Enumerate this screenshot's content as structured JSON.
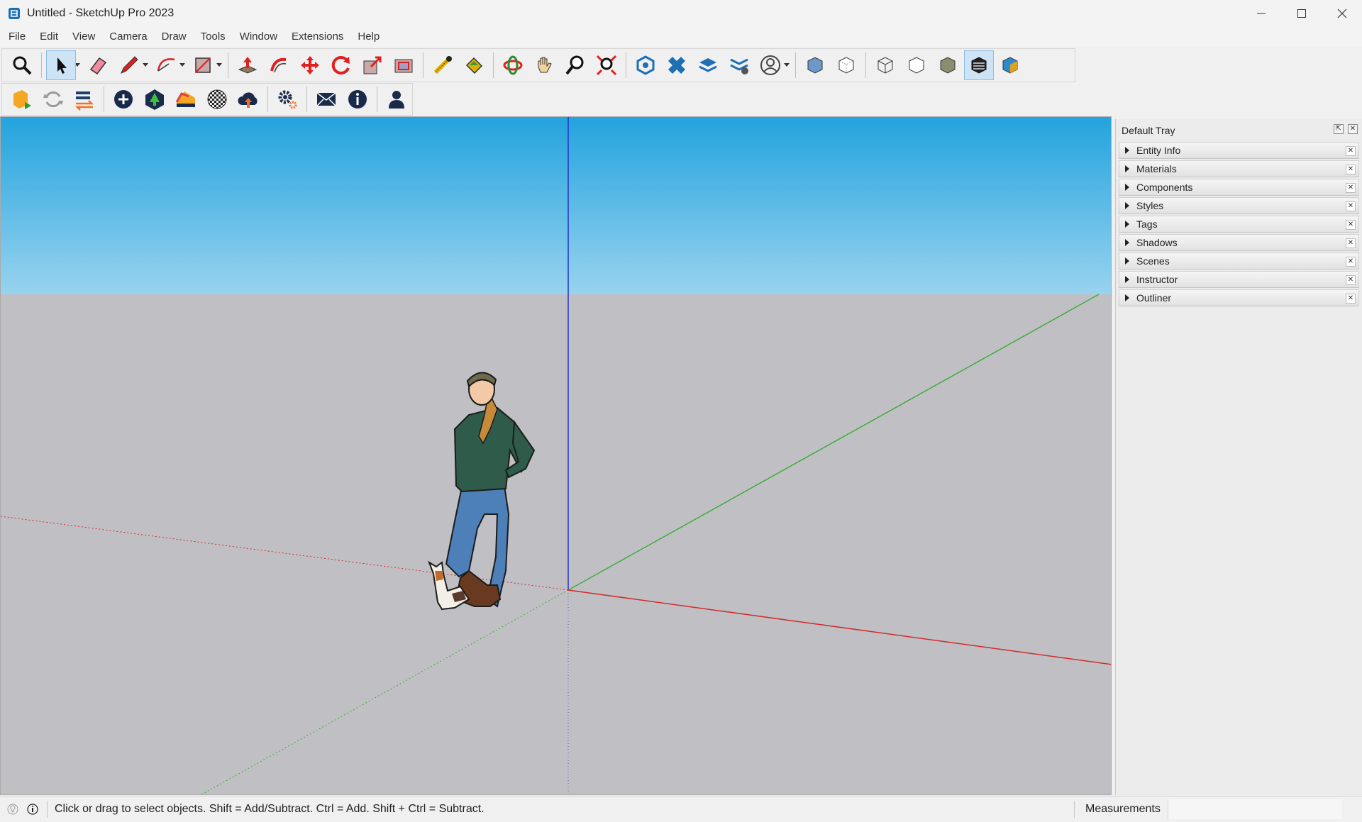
{
  "window": {
    "title": "Untitled - SketchUp Pro 2023",
    "controls": [
      "minimize",
      "maximize",
      "close"
    ]
  },
  "menu": [
    "File",
    "Edit",
    "View",
    "Camera",
    "Draw",
    "Tools",
    "Window",
    "Extensions",
    "Help"
  ],
  "toolbar_main": [
    "search-icon",
    "select-arrow-icon",
    "eraser-icon",
    "pencil-line-icon",
    "arc-icon",
    "rectangle-icon",
    "push-pull-icon",
    "follow-me-icon",
    "move-icon",
    "rotate-icon",
    "scale-icon",
    "offset-icon",
    "tape-measure-icon",
    "paint-bucket-icon",
    "orbit-icon",
    "pan-icon",
    "zoom-icon",
    "zoom-extents-icon",
    "3d-warehouse-icon",
    "extension-warehouse-icon",
    "layout-icon",
    "extension-manager-icon",
    "user-account-icon",
    "xray-icon",
    "back-edges-icon",
    "wireframe-icon",
    "hidden-line-icon",
    "shaded-icon",
    "shaded-textures-icon",
    "monochrome-icon"
  ],
  "toolbar_ext": [
    "sketchup-run-icon",
    "refresh-icon",
    "list-swap-icon",
    "add-circle-icon",
    "tree-icon",
    "swatch-icon",
    "checker-ball-icon",
    "cloud-upload-icon",
    "settings-gears-icon",
    "mail-icon",
    "info-icon",
    "person-icon"
  ],
  "tray": {
    "title": "Default Tray",
    "panels": [
      "Entity Info",
      "Materials",
      "Components",
      "Styles",
      "Tags",
      "Shadows",
      "Scenes",
      "Instructor",
      "Outliner"
    ]
  },
  "status": {
    "hint": "Click or drag to select objects. Shift = Add/Subtract. Ctrl = Add. Shift + Ctrl = Subtract.",
    "measurements_label": "Measurements",
    "measurements_value": ""
  },
  "colors": {
    "sky_top": "#23a3de",
    "sky_bottom": "#98d3ef",
    "ground": "#c0c0c4",
    "axis_red": "#d42a2a",
    "axis_green": "#3cae3c",
    "axis_blue": "#2233cc",
    "active_tool": "#cde4f7"
  }
}
